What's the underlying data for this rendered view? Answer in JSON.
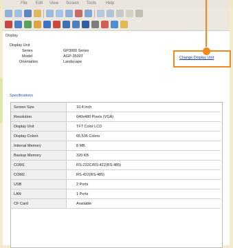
{
  "window": {
    "title": "",
    "menu": [
      "File",
      "Edit",
      "View",
      "Screen",
      "Tools",
      "Help"
    ]
  },
  "display": {
    "section_label": "Display",
    "unit_label": "Display Unit",
    "series_label": "Series",
    "series_value": "GP3000 Series",
    "model_label": "Model",
    "model_value": "AGP-3500T",
    "orientation_label": "Orientation",
    "orientation_value": "Landscape",
    "change_link": "Change Display Unit"
  },
  "specifications": {
    "label": "Specifications",
    "rows": [
      {
        "key": "Screen Size",
        "value": "10.4 inch"
      },
      {
        "key": "Resolution",
        "value": "640x480 Pixels (VGA)"
      },
      {
        "key": "Display Unit",
        "value": "TFT Color LCD"
      },
      {
        "key": "Display Colors",
        "value": "65,536 Colors"
      },
      {
        "key": "Internal Memory",
        "value": "8 MB"
      },
      {
        "key": "Backup Memory",
        "value": "320 KB"
      },
      {
        "key": "COM1",
        "value": "RS-232C/RS-422(RS-485)"
      },
      {
        "key": "COM2",
        "value": "RS-422(RS-485)"
      },
      {
        "key": "USB",
        "value": "2 Ports"
      },
      {
        "key": "LAN",
        "value": "1 Ports"
      },
      {
        "key": "CF Card",
        "value": "Available"
      }
    ]
  },
  "colors": {
    "accent": "#f08a1c",
    "link": "#1436b4",
    "frame": "#f3ebcd"
  }
}
